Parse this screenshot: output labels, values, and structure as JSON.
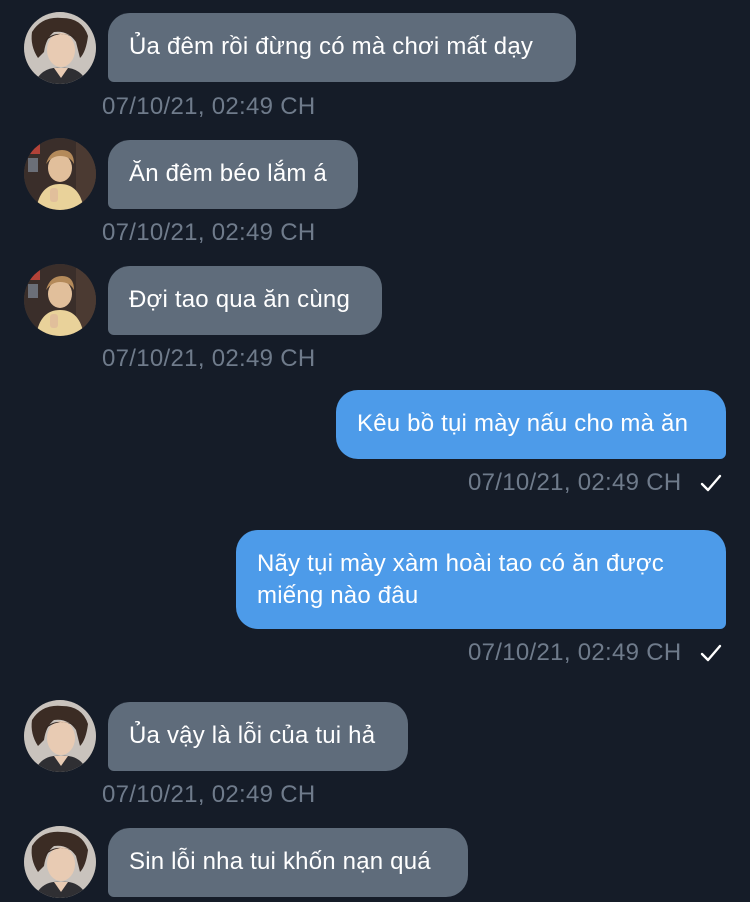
{
  "conversation": {
    "messages": [
      {
        "text": "Ủa đêm rồi đừng có mà chơi mất dạy",
        "time": "07/10/21, 02:49 CH"
      },
      {
        "text": "Ăn đêm béo lắm á",
        "time": "07/10/21, 02:49 CH"
      },
      {
        "text": "Đợi tao qua ăn cùng",
        "time": "07/10/21, 02:49 CH"
      },
      {
        "text": "Kêu bồ tụi mày nấu cho mà ăn",
        "time": "07/10/21, 02:49 CH"
      },
      {
        "text": "Nãy tụi mày xàm hoài tao có ăn được miếng nào đâu",
        "time": "07/10/21, 02:49 CH"
      },
      {
        "text": "Ủa vậy là lỗi của tui hả",
        "time": "07/10/21, 02:49 CH"
      },
      {
        "text": "Sin lỗi nha tui khốn nạn quá"
      }
    ]
  },
  "icons": {
    "avatar_a": "avatar-portrait",
    "avatar_b": "avatar-portrait",
    "read_receipt": "checkmark-icon"
  },
  "colors": {
    "background": "#151c28",
    "incoming_bubble": "#5f6c7b",
    "outgoing_bubble": "#4d9be9",
    "timestamp": "#6f7b8b"
  }
}
